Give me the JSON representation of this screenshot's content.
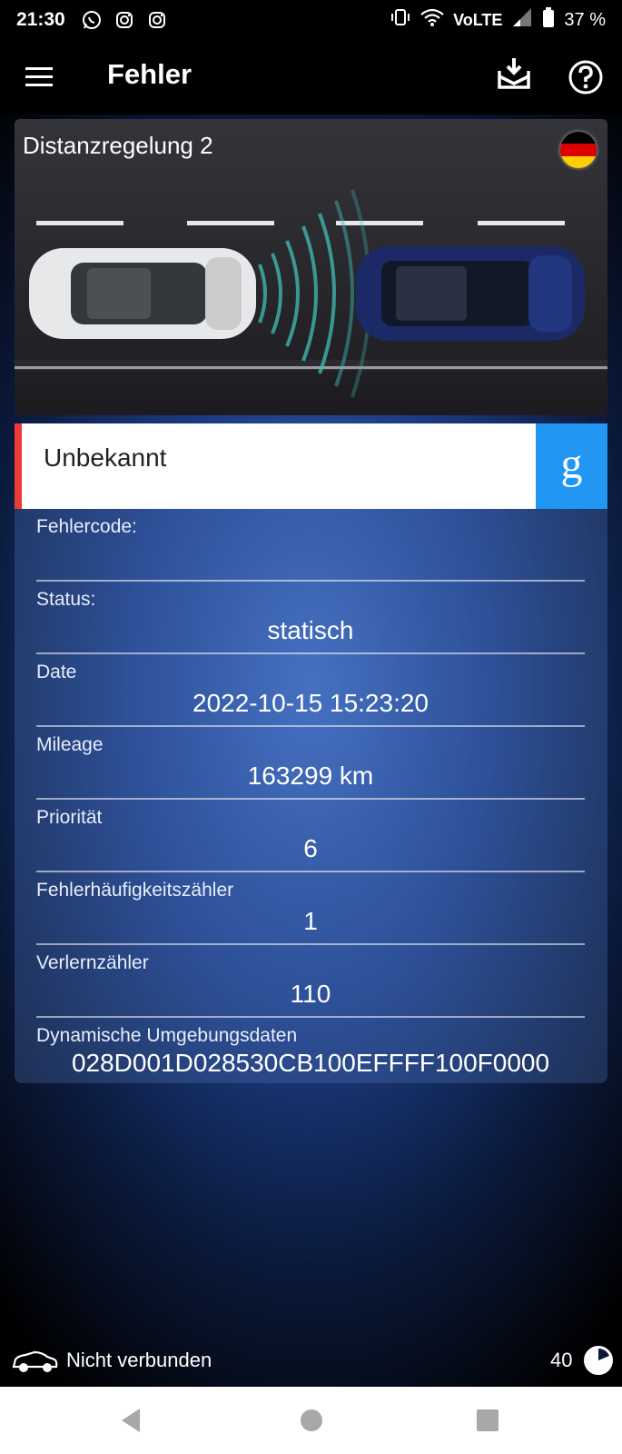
{
  "status_bar": {
    "time": "21:30",
    "notification_icons": [
      "whatsapp-icon",
      "instagram-icon",
      "instagram-icon"
    ],
    "system_icons": [
      "vibrate-icon",
      "wifi-icon",
      "volte-icon",
      "signal-icon",
      "battery-icon"
    ],
    "network_label": "VoLTE",
    "battery": "37 %"
  },
  "app_bar": {
    "title": "Fehler"
  },
  "module": {
    "name": "Distanzregelung 2",
    "flag": "germany-flag-icon"
  },
  "fault": {
    "description": "Unbekannt",
    "google_letter": "g",
    "accent_color": "#ee3a3a",
    "google_color": "#2196f3"
  },
  "details": [
    {
      "label": "Fehlercode:",
      "value": ""
    },
    {
      "label": "Status:",
      "value": "statisch"
    },
    {
      "label": "Date",
      "value": "2022-10-15 15:23:20"
    },
    {
      "label": "Mileage",
      "value": "163299 km"
    },
    {
      "label": "Priorität",
      "value": "6"
    },
    {
      "label": "Fehlerhäufigkeitszähler",
      "value": "1"
    },
    {
      "label": "Verlernzähler",
      "value": "110"
    },
    {
      "label": "Dynamische Umgebungsdaten",
      "value": "028D001D028530CB100EFFFF100F0000"
    }
  ],
  "connection": {
    "status": "Nicht verbunden",
    "count": "40"
  }
}
